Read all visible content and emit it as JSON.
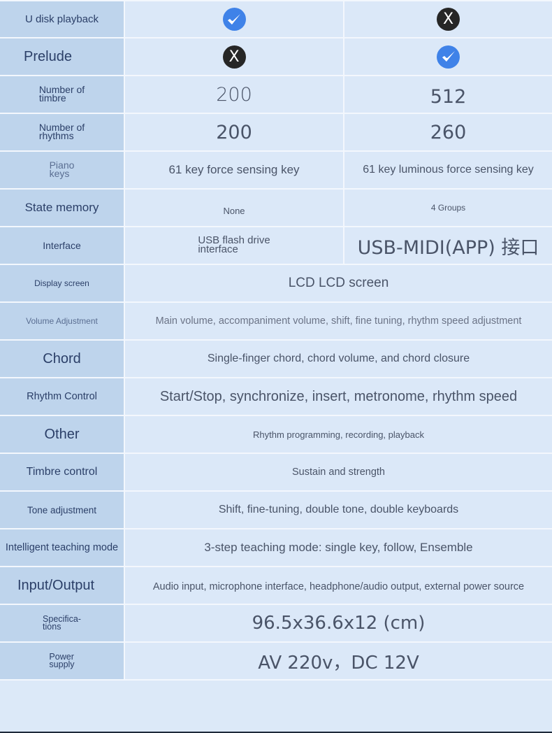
{
  "colors": {
    "label_bg": "#bed4ec",
    "value_bg": "#dbe8f8",
    "check_blue": "#3f82e8",
    "x_black": "#262626",
    "label_text": "#2b3f68",
    "value_text": "#4a5468"
  },
  "rows": [
    {
      "label": "U disk playback",
      "a_icon": "check",
      "b_icon": "x"
    },
    {
      "label": "Prelude",
      "a_icon": "x",
      "b_icon": "check"
    },
    {
      "label_l1": "Number of",
      "label_l2": "timbre",
      "a": "200",
      "b": "512"
    },
    {
      "label_l1": "Number of",
      "label_l2": "rhythms",
      "a": "200",
      "b": "260"
    },
    {
      "label_l1": "Piano",
      "label_l2": "keys",
      "a": "61 key force sensing key",
      "b": "61 key luminous force sensing key"
    },
    {
      "label": "State memory",
      "a": "None",
      "b": "4 Groups"
    },
    {
      "label": "Interface",
      "a_l1": "USB flash drive",
      "a_l2": "interface",
      "b": "USB-MIDI(APP) 接口"
    },
    {
      "label": "Display screen",
      "value": "LCD LCD screen"
    },
    {
      "label": "Volume Adjustment",
      "value": "Main volume, accompaniment volume, shift, fine tuning, rhythm speed adjustment"
    },
    {
      "label": "Chord",
      "value": "Single-finger chord, chord volume, and chord closure"
    },
    {
      "label": "Rhythm Control",
      "value": "Start/Stop, synchronize, insert, metronome, rhythm speed"
    },
    {
      "label": "Other",
      "value": "Rhythm programming, recording, playback"
    },
    {
      "label": "Timbre control",
      "value": "Sustain and strength"
    },
    {
      "label": "Tone adjustment",
      "value": "Shift, fine-tuning, double tone, double keyboards"
    },
    {
      "label": "Intelligent teaching mode",
      "value": "3-step teaching mode: single key, follow, Ensemble"
    },
    {
      "label": "Input/Output",
      "value": "Audio input, microphone interface, headphone/audio output, external power source"
    },
    {
      "label_l1": "Specifica-",
      "label_l2": "tions",
      "value": "96.5x36.6x12 (cm)"
    },
    {
      "label_l1": "Power",
      "label_l2": "supply",
      "value": "AV 220v，DC 12V"
    }
  ]
}
